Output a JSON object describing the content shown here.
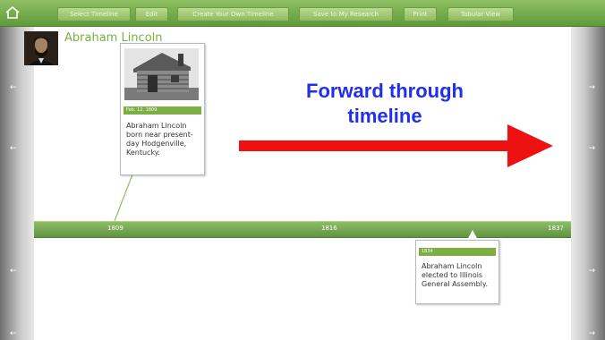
{
  "toolbar": {
    "buttons": [
      "Select Timeline",
      "Edit",
      "Create Your Own Timeline",
      "Save to My Research",
      "Print",
      "Tabular View"
    ]
  },
  "page": {
    "title": "Abraham Lincoln"
  },
  "events": [
    {
      "date": "Feb. 12, 1809",
      "text": "Abraham Lincoln born near present-day Hodgenville, Kentucky."
    },
    {
      "date": "1834",
      "text": "Abraham Lincoln elected to Illinois General Assembly."
    }
  ],
  "timeline": {
    "years": [
      "1809",
      "1816",
      "1837"
    ]
  },
  "overlay": {
    "line1": "Forward through",
    "line2": "timeline"
  },
  "icons": {
    "home": "home-icon",
    "scroll_left": "arrow-left-icon",
    "scroll_right": "arrow-right-icon",
    "annotation_arrow": "arrow-right-icon"
  },
  "colors": {
    "toolbar_green": "#6fa84a",
    "accent_green": "#7cae44",
    "overlay_text": "#1f2ef0",
    "overlay_arrow": "#ee1111"
  }
}
